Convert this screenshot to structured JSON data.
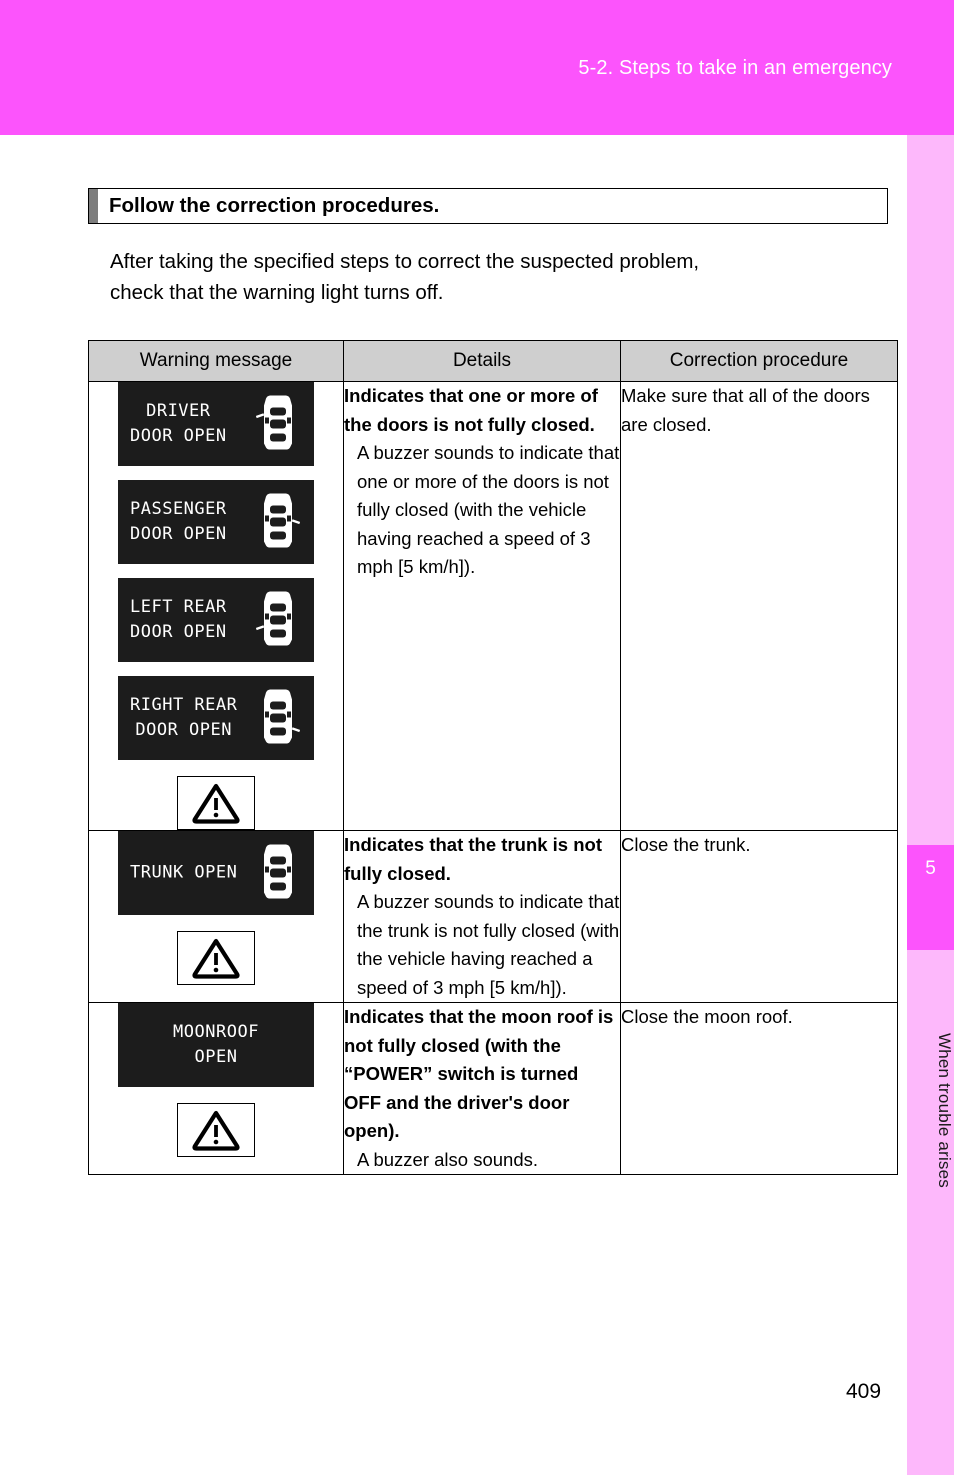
{
  "header": {
    "breadcrumb": "5-2. Steps to take in an emergency"
  },
  "side_rail": {
    "chapter_number": "5",
    "chapter_label": "When trouble arises"
  },
  "section": {
    "heading": "Follow the correction procedures.",
    "intro_line1": "After taking the specified steps to correct the suspected problem,",
    "intro_line2": "check that the warning light turns off."
  },
  "table": {
    "columns": [
      "Warning message",
      "Details",
      "Correction procedure"
    ],
    "rows": [
      {
        "displays": [
          {
            "lines": [
              "DRIVER",
              "DOOR OPEN"
            ],
            "icon": "car-top-view-icon",
            "door": "driver",
            "align": "left"
          },
          {
            "lines": [
              "PASSENGER",
              "DOOR OPEN"
            ],
            "icon": "car-top-view-icon",
            "door": "passenger",
            "align": "left"
          },
          {
            "lines": [
              "LEFT REAR",
              "DOOR OPEN"
            ],
            "icon": "car-top-view-icon",
            "door": "left-rear",
            "align": "left"
          },
          {
            "lines": [
              "RIGHT REAR",
              "DOOR OPEN"
            ],
            "icon": "car-top-view-icon",
            "door": "right-rear",
            "align": "left"
          }
        ],
        "symbol": "warning-triangle-icon",
        "details_lead": "Indicates that one or more of the doors is not fully closed.",
        "details_body": "A buzzer sounds to indicate that one or more of the doors is not fully closed (with the vehicle having reached a speed of 3 mph [5 km/h]).",
        "correction": "Make sure that all of the doors are closed."
      },
      {
        "displays": [
          {
            "lines": [
              "TRUNK OPEN"
            ],
            "icon": "car-top-view-icon",
            "door": "trunk",
            "align": "left"
          }
        ],
        "symbol": "warning-triangle-icon",
        "details_lead": "Indicates that the trunk is not fully closed.",
        "details_body": "A buzzer sounds to indicate that the trunk is not fully closed (with the vehicle having reached a speed of 3 mph [5 km/h]).",
        "correction": "Close the trunk."
      },
      {
        "displays": [
          {
            "lines": [
              "MOONROOF",
              "OPEN"
            ],
            "icon": "none",
            "door": "none",
            "align": "center"
          }
        ],
        "symbol": "warning-triangle-icon",
        "details_lead": "Indicates that the moon roof is not fully closed (with the “POWER” switch is turned OFF and the driver's door open).",
        "details_body": "A buzzer also sounds.",
        "correction": "Close the moon roof."
      }
    ]
  },
  "page_number": "409",
  "colors": {
    "header_band": "#fc54fc",
    "side_rail": "#fdb8fb",
    "chapter_block": "#fc54fc",
    "table_header_fill": "#cfcfcf",
    "lcd_background": "#1c1c1c",
    "lcd_text": "#ffffff",
    "heading_marker": "#7d7d7d"
  }
}
